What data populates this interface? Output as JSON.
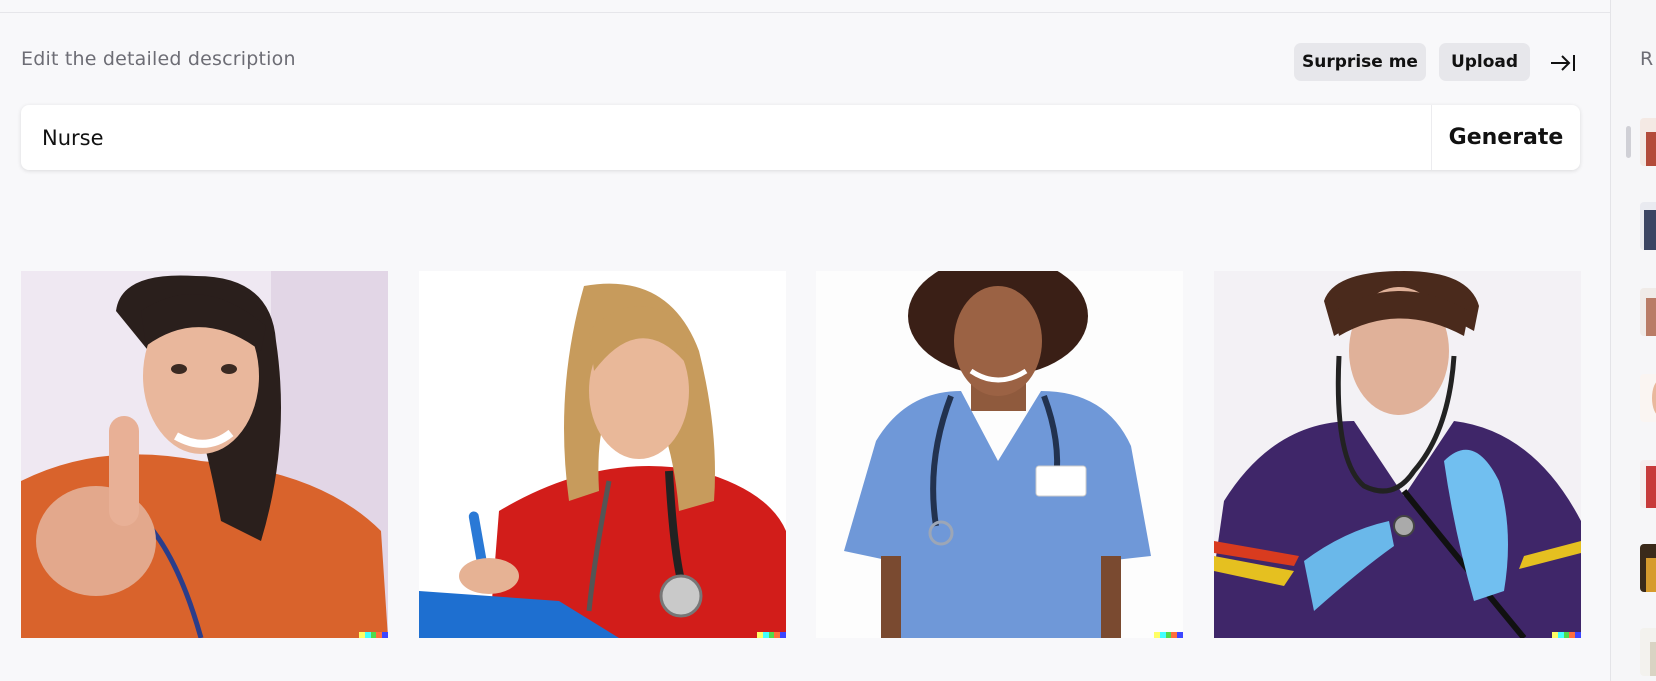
{
  "header": {
    "description_label": "Edit the detailed description",
    "surprise_label": "Surprise me",
    "upload_label": "Upload",
    "collapse_icon": "collapse-right-icon"
  },
  "prompt": {
    "value": "Nurse",
    "generate_label": "Generate"
  },
  "results": [
    {
      "subject": "nurse-orange-scrubs-pointing"
    },
    {
      "subject": "nurse-red-scrubs-clipboard"
    },
    {
      "subject": "nurse-blue-scrubs-badge"
    },
    {
      "subject": "nurse-purple-scrubs-stethoscope"
    }
  ],
  "watermark_colors": [
    "#ffff66",
    "#42ffff",
    "#51da4c",
    "#ff6e3c",
    "#3c46ff"
  ],
  "history": {
    "label": "R",
    "thumbnails": [
      {
        "tone": "#b34b3a"
      },
      {
        "tone": "#3a4463"
      },
      {
        "tone": "#b97c66"
      },
      {
        "tone": "#e9b89c"
      },
      {
        "tone": "#c73a3a"
      },
      {
        "tone": "#d69b2e"
      },
      {
        "tone": "#d9d3c3"
      }
    ]
  }
}
